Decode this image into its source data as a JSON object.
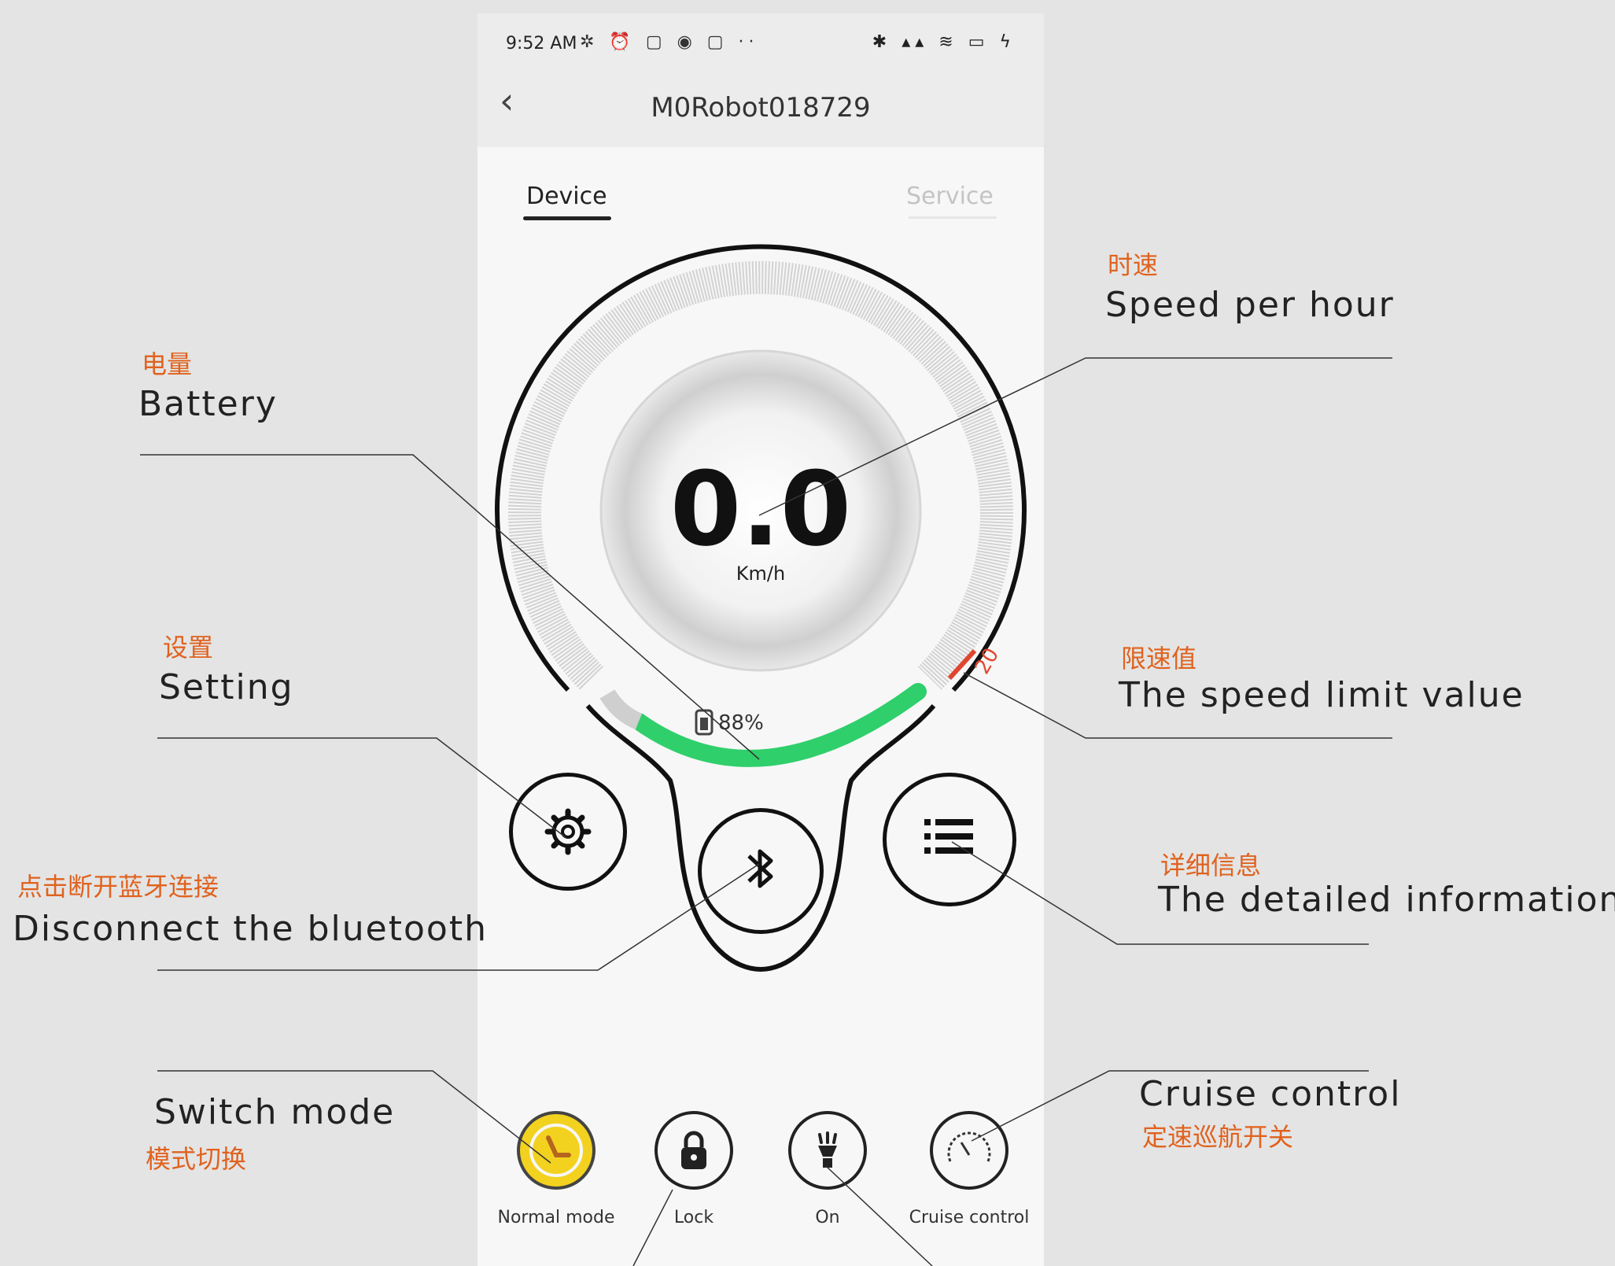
{
  "status": {
    "time": "9:52 AM",
    "left_icons": "✲ ⏰ ▢ ◉ ▢ ··",
    "right_icons": "✱ ▴▴ ≋ ▭ ϟ"
  },
  "header": {
    "title": "M0Robot018729"
  },
  "tabs": [
    {
      "label": "Device"
    },
    {
      "label": "Service"
    }
  ],
  "gauge": {
    "speed": "0.0",
    "unit": "Km/h",
    "battery": "88%",
    "battery_level": 0.88,
    "limit": "20"
  },
  "modes": [
    {
      "label": "Normal mode"
    },
    {
      "label": "Lock"
    },
    {
      "label": "On"
    },
    {
      "label": "Cruise control"
    }
  ],
  "annotations": {
    "speed": {
      "cn": "时速",
      "en": "Speed per hour"
    },
    "battery": {
      "cn": "电量",
      "en": "Battery"
    },
    "setting": {
      "cn": "设置",
      "en": "Setting"
    },
    "limit": {
      "cn": "限速值",
      "en": "The speed limit value"
    },
    "detail": {
      "cn": "详细信息",
      "en": "The detailed information"
    },
    "bluetooth": {
      "cn": "点击断开蓝牙连接",
      "en": "Disconnect the bluetooth"
    },
    "mode": {
      "cn": "模式切换",
      "en": "Switch mode"
    },
    "cruise": {
      "cn": "定速巡航开关",
      "en": "Cruise control"
    }
  },
  "colors": {
    "accent_green": "#2fcf6b",
    "limit_red": "#e0462f",
    "annotation_orange": "#e0621e",
    "mode_yellow": "#f3d21f"
  }
}
